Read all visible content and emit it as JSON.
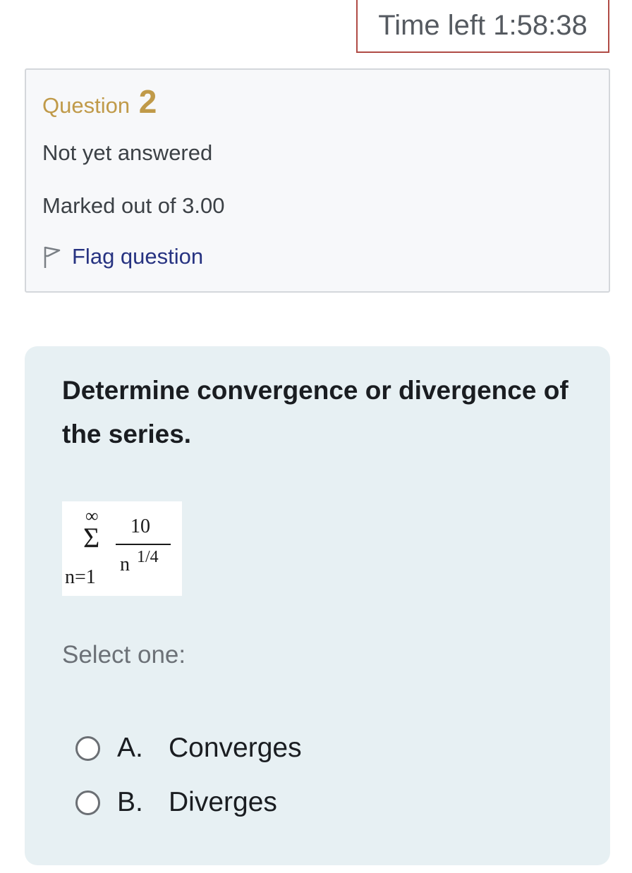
{
  "timer": {
    "label": "Time left 1:58:38"
  },
  "info": {
    "question_label": "Question",
    "question_number": "2",
    "state": "Not yet answered",
    "grade": "Marked out of 3.00",
    "flag_label": "Flag question"
  },
  "question": {
    "text": "Determine convergence or divergence of the series.",
    "formula": {
      "upper": "∞",
      "sigma": "Σ",
      "lower": "n=1",
      "numerator": "10",
      "denominator_base": "n",
      "denominator_exponent": "1/4"
    },
    "select_prompt": "Select one:",
    "options": [
      {
        "letter": "A.",
        "label": "Converges"
      },
      {
        "letter": "B.",
        "label": "Diverges"
      }
    ]
  },
  "colors": {
    "timer_border": "#b04b45",
    "question_title": "#c09a49",
    "flag_link": "#273381",
    "question_bg": "#e7f0f3",
    "info_bg": "#f7f8fa"
  },
  "icons": {
    "flag": "flag-outline-icon"
  }
}
